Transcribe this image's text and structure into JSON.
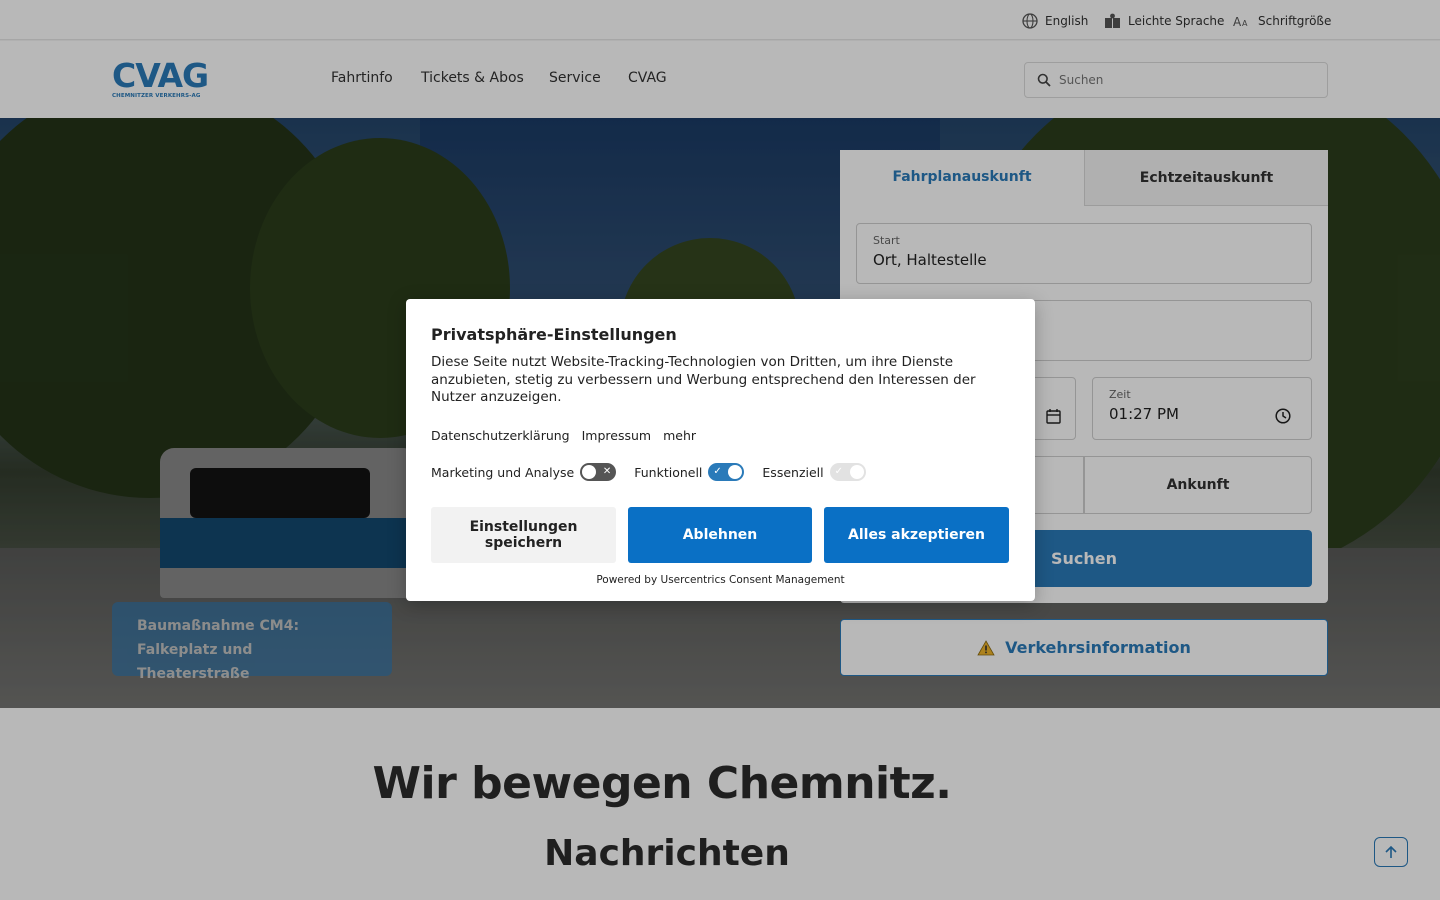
{
  "utility_bar": {
    "items": [
      {
        "label": "English",
        "icon": "globe-icon"
      },
      {
        "label": "Leichte Sprache",
        "icon": "easy-language-icon"
      },
      {
        "label": "Schriftgröße",
        "icon": "font-size-icon"
      }
    ]
  },
  "header": {
    "logo_main": "CVAG",
    "logo_sub": "CHEMNITZER VERKEHRS-AG",
    "nav": [
      "Fahrtinfo",
      "Tickets & Abos",
      "Service",
      "CVAG"
    ],
    "search_placeholder": "Suchen"
  },
  "hero": {
    "news_card": "Baumaßnahme CM4: Falkeplatz und Theaterstraße",
    "planner": {
      "tabs": [
        "Fahrplanauskunft",
        "Echtzeitauskunft"
      ],
      "start_label": "Start",
      "start_value": "Ort, Haltestelle",
      "time_label": "Zeit",
      "time_value": "01:27 PM",
      "arrival_label": "Ankunft",
      "search_button": "Suchen"
    },
    "traffic_info": "Verkehrsinformation"
  },
  "main": {
    "headline": "Wir bewegen Chemnitz.",
    "subheadline": "Nachrichten"
  },
  "consent": {
    "title": "Privatsphäre-Einstellungen",
    "text": "Diese Seite nutzt Website-Tracking-Technologien von Dritten, um ihre Dienste anzubieten, stetig zu verbessern und Werbung entsprechend den Interessen der Nutzer anzuzeigen.",
    "links": [
      "Datenschutzerklärung",
      "Impressum",
      "mehr"
    ],
    "toggles": [
      {
        "label": "Marketing und Analyse",
        "state": "off"
      },
      {
        "label": "Funktionell",
        "state": "on"
      },
      {
        "label": "Essenziell",
        "state": "locked-on"
      }
    ],
    "buttons": {
      "save": "Einstellungen speichern",
      "deny": "Ablehnen",
      "accept": "Alles akzeptieren"
    },
    "powered_by": "Powered by Usercentrics Consent Management"
  },
  "colors": {
    "brand_blue": "#2a7ab9",
    "consent_blue": "#0a70c5"
  }
}
